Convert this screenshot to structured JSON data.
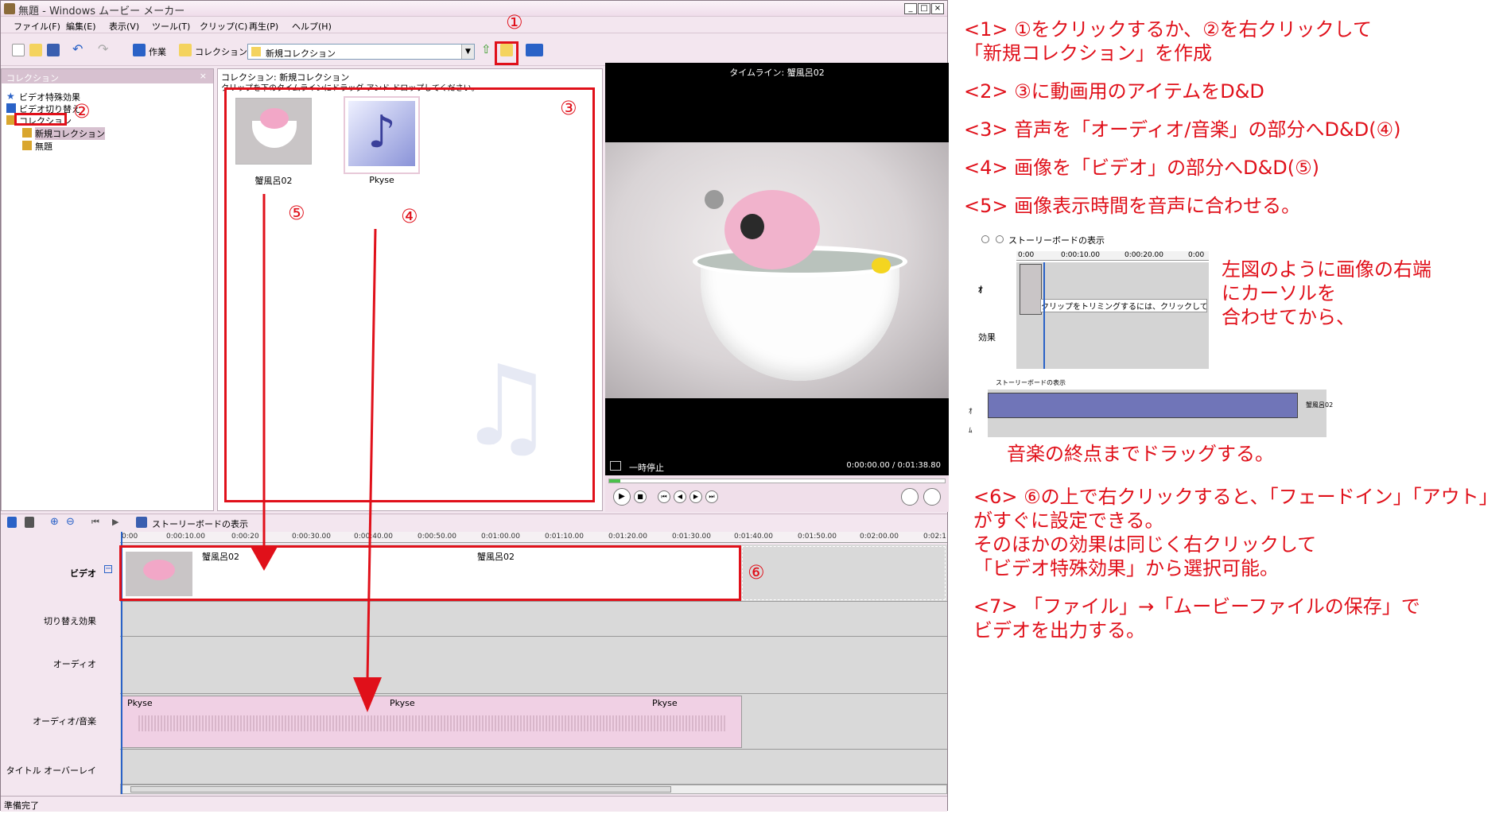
{
  "window": {
    "title": "無題 - Windows ムービー メーカー",
    "buttons": {
      "min": "_",
      "max": "□",
      "close": "×"
    }
  },
  "menu": [
    "ファイル(F)",
    "編集(E)",
    "表示(V)",
    "ツール(T)",
    "クリップ(C)",
    "再生(P)",
    "ヘルプ(H)"
  ],
  "toolbar": {
    "tasks_label": "作業",
    "collections_label": "コレクション",
    "combo_value": "新規コレクション"
  },
  "collections_pane": {
    "header": "コレクション",
    "close": "×",
    "tree": [
      "ビデオ特殊効果",
      "ビデオ切り替え",
      "コレクション",
      "新規コレクション",
      "無題"
    ]
  },
  "collection_view": {
    "title": "コレクション: 新規コレクション",
    "hint": "クリップを下のタイムラインにドラッグ アンド ドロップしてください。",
    "clips": [
      {
        "name": "蟹風呂02",
        "type": "image"
      },
      {
        "name": "Pkyse",
        "type": "audio"
      }
    ]
  },
  "preview": {
    "title": "タイムライン: 蟹風呂02",
    "state": "一時停止",
    "time": "0:00:00.00 / 0:01:38.80"
  },
  "timeline": {
    "storyboard_label": "ストーリーボードの表示",
    "ruler": [
      "0:00",
      "0:00:10.00",
      "0:00:20",
      "0:00:30.00",
      "0:00:40.00",
      "0:00:50.00",
      "0:01:00.00",
      "0:01:10.00",
      "0:01:20.00",
      "0:01:30.00",
      "0:01:40.00",
      "0:01:50.00",
      "0:02:00.00",
      "0:02:1"
    ],
    "tracks": {
      "video": "ビデオ",
      "transition": "切り替え効果",
      "audio": "オーディオ",
      "audio_music": "オーディオ/音楽",
      "title_overlay": "タイトル オーバーレイ"
    },
    "video_clip_label_1": "蟹風呂02",
    "video_clip_label_2": "蟹風呂02",
    "audio_clip_labels": [
      "Pkyse",
      "Pkyse",
      "Pkyse"
    ]
  },
  "status": "準備完了",
  "markers": {
    "m1": "①",
    "m2": "②",
    "m3": "③",
    "m4": "④",
    "m5": "⑤",
    "m6": "⑥"
  },
  "instructions": {
    "s1a": "<1> ①をクリックするか、②を右クリックして",
    "s1b": "「新規コレクション」を作成",
    "s2": "<2> ③に動画用のアイテムをD&D",
    "s3": "<3> 音声を「オーディオ/音楽」の部分へD&D(④)",
    "s4": "<4> 画像を「ビデオ」の部分へD&D(⑤)",
    "s5": "<5> 画像表示時間を音声に合わせる。",
    "side_a": "左図のように画像の右端",
    "side_b": "にカーソルを",
    "side_c": "合わせてから、",
    "drag_note": "音楽の終点までドラッグする。",
    "s6a": "<6> ⑥の上で右クリックすると、「フェードイン」「アウト」",
    "s6b": "がすぐに設定できる。",
    "s6c": "そのほかの効果は同じく右クリックして",
    "s6d": "「ビデオ特殊効果」から選択可能。",
    "s7a": "<7> 「ファイル」→「ムービーファイルの保存」で",
    "s7b": "ビデオを出力する。"
  },
  "mini1": {
    "storyboard": "ストーリーボードの表示",
    "ruler": [
      "0:00",
      "0:00:10.00",
      "0:00:20.00",
      "0:00"
    ],
    "video": "ｵ",
    "effect": "効果",
    "tooltip": "クリップをトリミングするには、クリックしてからドラ"
  },
  "mini2": {
    "storyboard": "ストーリーボードの表示",
    "video": "ｵ",
    "row2": "ﾑ",
    "end_label": "蟹風呂02"
  },
  "colors": {
    "accent_red": "#e0101a",
    "window_bg": "#f3e6ef",
    "audio_clip": "#f0d0e4"
  }
}
